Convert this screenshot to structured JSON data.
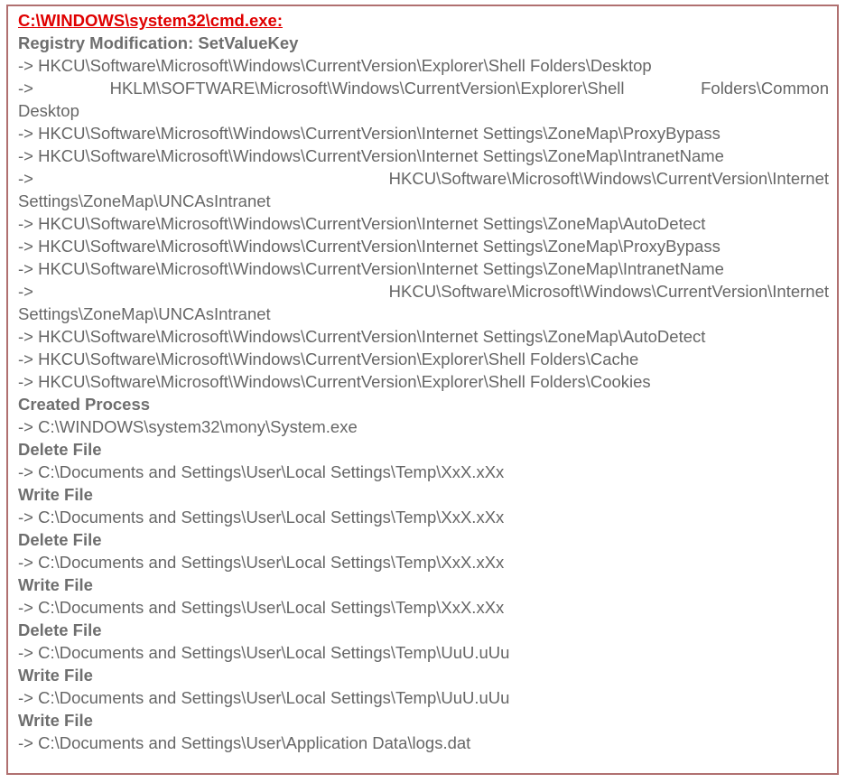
{
  "title": "C:\\WINDOWS\\system32\\cmd.exe:",
  "lines": [
    {
      "text": "Registry Modification: SetValueKey",
      "style": "bold"
    },
    {
      "text": "-> HKCU\\Software\\Microsoft\\Windows\\CurrentVersion\\Explorer\\Shell Folders\\Desktop",
      "style": "normal"
    },
    {
      "parts": [
        "->",
        "HKLM\\SOFTWARE\\Microsoft\\Windows\\CurrentVersion\\Explorer\\Shell",
        "Folders\\Common"
      ],
      "style": "justify"
    },
    {
      "text": "Desktop",
      "style": "normal"
    },
    {
      "text": "-> HKCU\\Software\\Microsoft\\Windows\\CurrentVersion\\Internet Settings\\ZoneMap\\ProxyBypass",
      "style": "normal"
    },
    {
      "text": "-> HKCU\\Software\\Microsoft\\Windows\\CurrentVersion\\Internet Settings\\ZoneMap\\IntranetName",
      "style": "normal"
    },
    {
      "parts": [
        "->",
        "HKCU\\Software\\Microsoft\\Windows\\CurrentVersion\\Internet"
      ],
      "style": "justify"
    },
    {
      "text": "Settings\\ZoneMap\\UNCAsIntranet",
      "style": "normal"
    },
    {
      "text": "-> HKCU\\Software\\Microsoft\\Windows\\CurrentVersion\\Internet Settings\\ZoneMap\\AutoDetect",
      "style": "normal"
    },
    {
      "text": "-> HKCU\\Software\\Microsoft\\Windows\\CurrentVersion\\Internet Settings\\ZoneMap\\ProxyBypass",
      "style": "normal"
    },
    {
      "text": "-> HKCU\\Software\\Microsoft\\Windows\\CurrentVersion\\Internet Settings\\ZoneMap\\IntranetName",
      "style": "normal"
    },
    {
      "parts": [
        "->",
        "HKCU\\Software\\Microsoft\\Windows\\CurrentVersion\\Internet"
      ],
      "style": "justify"
    },
    {
      "text": "Settings\\ZoneMap\\UNCAsIntranet",
      "style": "normal"
    },
    {
      "text": "-> HKCU\\Software\\Microsoft\\Windows\\CurrentVersion\\Internet Settings\\ZoneMap\\AutoDetect",
      "style": "normal"
    },
    {
      "text": "-> HKCU\\Software\\Microsoft\\Windows\\CurrentVersion\\Explorer\\Shell Folders\\Cache",
      "style": "normal"
    },
    {
      "text": "-> HKCU\\Software\\Microsoft\\Windows\\CurrentVersion\\Explorer\\Shell Folders\\Cookies",
      "style": "normal"
    },
    {
      "text": "Created Process",
      "style": "bold"
    },
    {
      "text": "-> C:\\WINDOWS\\system32\\mony\\System.exe",
      "style": "normal"
    },
    {
      "text": "Delete File",
      "style": "bold"
    },
    {
      "text": "-> C:\\Documents and Settings\\User\\Local Settings\\Temp\\XxX.xXx",
      "style": "normal"
    },
    {
      "text": "Write File",
      "style": "bold"
    },
    {
      "text": "-> C:\\Documents and Settings\\User\\Local Settings\\Temp\\XxX.xXx",
      "style": "normal"
    },
    {
      "text": "Delete File",
      "style": "bold"
    },
    {
      "text": "-> C:\\Documents and Settings\\User\\Local Settings\\Temp\\XxX.xXx",
      "style": "normal"
    },
    {
      "text": "Write File",
      "style": "bold"
    },
    {
      "text": "-> C:\\Documents and Settings\\User\\Local Settings\\Temp\\XxX.xXx",
      "style": "normal"
    },
    {
      "text": "Delete File",
      "style": "bold"
    },
    {
      "text": "-> C:\\Documents and Settings\\User\\Local Settings\\Temp\\UuU.uUu",
      "style": "normal"
    },
    {
      "text": "Write File",
      "style": "bold"
    },
    {
      "text": "-> C:\\Documents and Settings\\User\\Local Settings\\Temp\\UuU.uUu",
      "style": "normal"
    },
    {
      "text": "Write File",
      "style": "bold"
    },
    {
      "text": "-> C:\\Documents and Settings\\User\\Application Data\\logs.dat",
      "style": "normal"
    }
  ],
  "colors": {
    "title": "#e00000",
    "text": "#666666",
    "border": "#b07070"
  }
}
